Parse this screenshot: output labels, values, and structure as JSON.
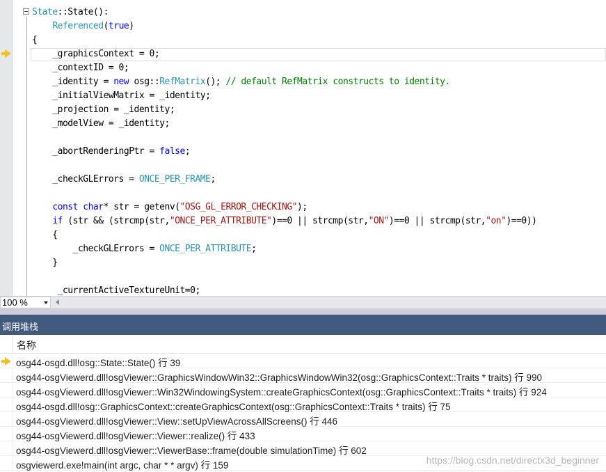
{
  "editor": {
    "lines": [
      [
        {
          "t": "State",
          "c": "type"
        },
        {
          "t": "::State():"
        }
      ],
      [
        {
          "t": "    "
        },
        {
          "t": "Referenced",
          "c": "type"
        },
        {
          "t": "("
        },
        {
          "t": "true",
          "c": "kw"
        },
        {
          "t": ")"
        }
      ],
      [
        {
          "t": "{"
        }
      ],
      [
        {
          "t": "    _graphicsContext = 0;"
        }
      ],
      [
        {
          "t": "    _contextID = 0;"
        }
      ],
      [
        {
          "t": "    _identity = "
        },
        {
          "t": "new",
          "c": "kw"
        },
        {
          "t": " osg::"
        },
        {
          "t": "RefMatrix",
          "c": "type"
        },
        {
          "t": "(); "
        },
        {
          "t": "// default RefMatrix constructs to identity.",
          "c": "cmt"
        }
      ],
      [
        {
          "t": "    _initialViewMatrix = _identity;"
        }
      ],
      [
        {
          "t": "    _projection = _identity;"
        }
      ],
      [
        {
          "t": "    _modelView = _identity;"
        }
      ],
      [
        {
          "t": ""
        }
      ],
      [
        {
          "t": "    _abortRenderingPtr = "
        },
        {
          "t": "false",
          "c": "kw"
        },
        {
          "t": ";"
        }
      ],
      [
        {
          "t": ""
        }
      ],
      [
        {
          "t": "    _checkGLErrors = "
        },
        {
          "t": "ONCE_PER_FRAME",
          "c": "type"
        },
        {
          "t": ";"
        }
      ],
      [
        {
          "t": ""
        }
      ],
      [
        {
          "t": "    "
        },
        {
          "t": "const",
          "c": "kw"
        },
        {
          "t": " "
        },
        {
          "t": "char",
          "c": "kw"
        },
        {
          "t": "* str = getenv("
        },
        {
          "t": "\"OSG_GL_ERROR_CHECKING\"",
          "c": "str"
        },
        {
          "t": ");"
        }
      ],
      [
        {
          "t": "    "
        },
        {
          "t": "if",
          "c": "kw"
        },
        {
          "t": " (str && (strcmp(str,"
        },
        {
          "t": "\"ONCE_PER_ATTRIBUTE\"",
          "c": "str"
        },
        {
          "t": ")==0 || strcmp(str,"
        },
        {
          "t": "\"ON\"",
          "c": "str"
        },
        {
          "t": ")==0 || strcmp(str,"
        },
        {
          "t": "\"on\"",
          "c": "str"
        },
        {
          "t": ")==0))"
        }
      ],
      [
        {
          "t": "    {"
        }
      ],
      [
        {
          "t": "        _checkGLErrors = "
        },
        {
          "t": "ONCE_PER_ATTRIBUTE",
          "c": "type"
        },
        {
          "t": ";"
        }
      ],
      [
        {
          "t": "    }"
        }
      ],
      [
        {
          "t": ""
        }
      ],
      [
        {
          "t": "     _currentActiveTextureUnit=0;"
        }
      ]
    ]
  },
  "zoom": {
    "value": "100 %"
  },
  "panel": {
    "title": "调用堆栈",
    "column_name": "名称",
    "rows": [
      {
        "text": "osg44-osgd.dll!osg::State::State() 行 39",
        "current": true
      },
      {
        "text": "osg44-osgViewerd.dll!osgViewer::GraphicsWindowWin32::GraphicsWindowWin32(osg::GraphicsContext::Traits * traits) 行 990",
        "current": false
      },
      {
        "text": "osg44-osgViewerd.dll!osgViewer::Win32WindowingSystem::createGraphicsContext(osg::GraphicsContext::Traits * traits) 行 924",
        "current": false
      },
      {
        "text": "osg44-osgd.dll!osg::GraphicsContext::createGraphicsContext(osg::GraphicsContext::Traits * traits) 行 75",
        "current": false
      },
      {
        "text": "osg44-osgViewerd.dll!osgViewer::View::setUpViewAcrossAllScreens() 行 446",
        "current": false
      },
      {
        "text": "osg44-osgViewerd.dll!osgViewer::Viewer::realize() 行 433",
        "current": false
      },
      {
        "text": "osg44-osgViewerd.dll!osgViewer::ViewerBase::frame(double simulationTime) 行 602",
        "current": false
      },
      {
        "text": "osgviewerd.exe!main(int argc, char * * argv) 行 159",
        "current": false
      }
    ]
  },
  "watermark": "https://blog.csdn.net/directx3d_beginner",
  "colors": {
    "keyword": "#0000ff",
    "type": "#2b91af",
    "string": "#a31515",
    "comment": "#008000",
    "panel_header": "#425a7d",
    "current_arrow": "#f2c021"
  },
  "icons": {
    "current_statement": "yellow-arrow-icon",
    "fold": "collapse-box-icon",
    "zoom_dropdown": "chevron-down-icon",
    "scroll_left": "triangle-left-icon"
  }
}
